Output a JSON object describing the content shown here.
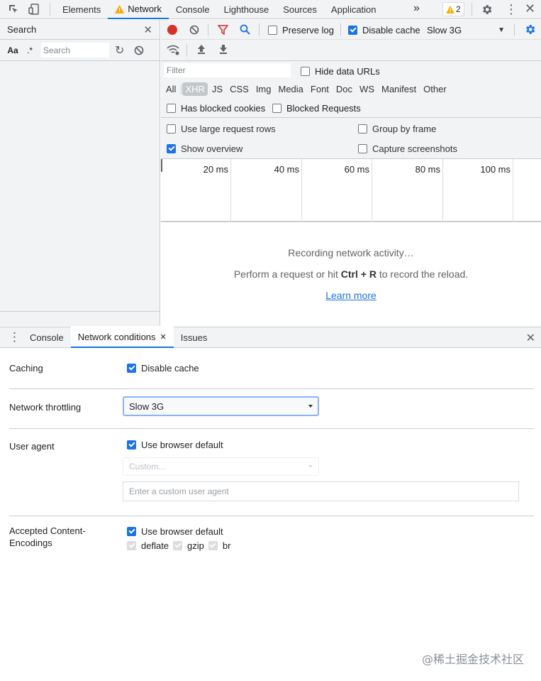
{
  "top_tabs": [
    {
      "label": "Elements"
    },
    {
      "label": "Network"
    },
    {
      "label": "Console"
    },
    {
      "label": "Lighthouse"
    },
    {
      "label": "Sources"
    },
    {
      "label": "Application"
    }
  ],
  "warnings_count": "2",
  "search_panel": {
    "title": "Search",
    "case_label": "Aa",
    "regex_label": ".*",
    "placeholder": "Search"
  },
  "network_toolbar": {
    "preserve_log": "Preserve log",
    "disable_cache": "Disable cache",
    "throttle": "Slow 3G"
  },
  "filter": {
    "placeholder": "Filter",
    "hide_data_urls": "Hide data URLs",
    "types": [
      "All",
      "XHR",
      "JS",
      "CSS",
      "Img",
      "Media",
      "Font",
      "Doc",
      "WS",
      "Manifest",
      "Other"
    ],
    "selected_type": "XHR",
    "blocked_cookies": "Has blocked cookies",
    "blocked_requests": "Blocked Requests"
  },
  "settings": {
    "large_rows": "Use large request rows",
    "group_by_frame": "Group by frame",
    "show_overview": "Show overview",
    "capture_screenshots": "Capture screenshots"
  },
  "timeline_ticks": [
    "20 ms",
    "40 ms",
    "60 ms",
    "80 ms",
    "100 ms"
  ],
  "empty_state": {
    "recording": "Recording network activity…",
    "hint_prefix": "Perform a request or hit ",
    "hint_keys": "Ctrl + R",
    "hint_suffix": " to record the reload.",
    "learn_more": "Learn more"
  },
  "drawer_tabs": [
    {
      "label": "Console"
    },
    {
      "label": "Network conditions"
    },
    {
      "label": "Issues"
    }
  ],
  "network_conditions": {
    "caching_label": "Caching",
    "disable_cache": "Disable cache",
    "throttling_label": "Network throttling",
    "throttling_value": "Slow 3G",
    "user_agent_label": "User agent",
    "use_browser_default": "Use browser default",
    "custom_select": "Custom...",
    "custom_ua_placeholder": "Enter a custom user agent",
    "encodings_label": "Accepted Content-Encodings",
    "encodings_default": "Use browser default",
    "encodings": [
      "deflate",
      "gzip",
      "br"
    ]
  },
  "watermark": "@稀土掘金技术社区",
  "colors": {
    "accent": "#1a73e8",
    "record": "#d93025",
    "warning": "#f9ab00"
  }
}
